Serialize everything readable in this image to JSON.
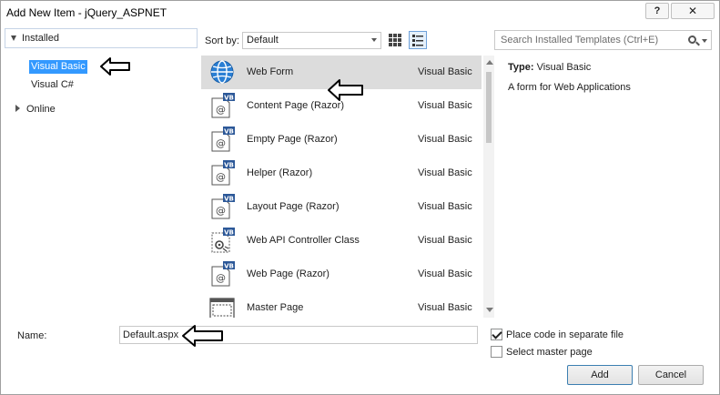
{
  "window": {
    "title": "Add New Item - jQuery_ASPNET",
    "help_glyph": "?",
    "close_glyph": "✕"
  },
  "tree": {
    "installed_label": "Installed",
    "items": [
      {
        "label": "Visual Basic",
        "selected": true
      },
      {
        "label": "Visual C#",
        "selected": false
      }
    ],
    "online_label": "Online"
  },
  "sort": {
    "label": "Sort by:",
    "value": "Default"
  },
  "search": {
    "placeholder": "Search Installed Templates (Ctrl+E)"
  },
  "templates": [
    {
      "name": "Web Form",
      "lang": "Visual Basic",
      "icon": "web-form-globe-icon",
      "selected": true
    },
    {
      "name": "Content Page (Razor)",
      "lang": "Visual Basic",
      "icon": "vb-razor-page-icon"
    },
    {
      "name": "Empty Page (Razor)",
      "lang": "Visual Basic",
      "icon": "vb-razor-page-icon"
    },
    {
      "name": "Helper (Razor)",
      "lang": "Visual Basic",
      "icon": "vb-razor-page-icon"
    },
    {
      "name": "Layout Page (Razor)",
      "lang": "Visual Basic",
      "icon": "vb-razor-page-icon"
    },
    {
      "name": "Web API Controller Class",
      "lang": "Visual Basic",
      "icon": "vb-controller-class-icon"
    },
    {
      "name": "Web Page (Razor)",
      "lang": "Visual Basic",
      "icon": "vb-razor-page-icon"
    },
    {
      "name": "Master Page",
      "lang": "Visual Basic",
      "icon": "master-page-icon"
    }
  ],
  "details": {
    "type_label": "Type:",
    "type_value": "Visual Basic",
    "description": "A form for Web Applications"
  },
  "name_field": {
    "label": "Name:",
    "value": "Default.aspx"
  },
  "options": {
    "place_code_label": "Place code in separate file",
    "place_code_checked": true,
    "master_page_label": "Select master page",
    "master_page_checked": false
  },
  "buttons": {
    "add": "Add",
    "cancel": "Cancel"
  },
  "colors": {
    "selection": "#3399ff",
    "row_selected": "#dcdcdc",
    "vb_badge": "#2c5898"
  }
}
